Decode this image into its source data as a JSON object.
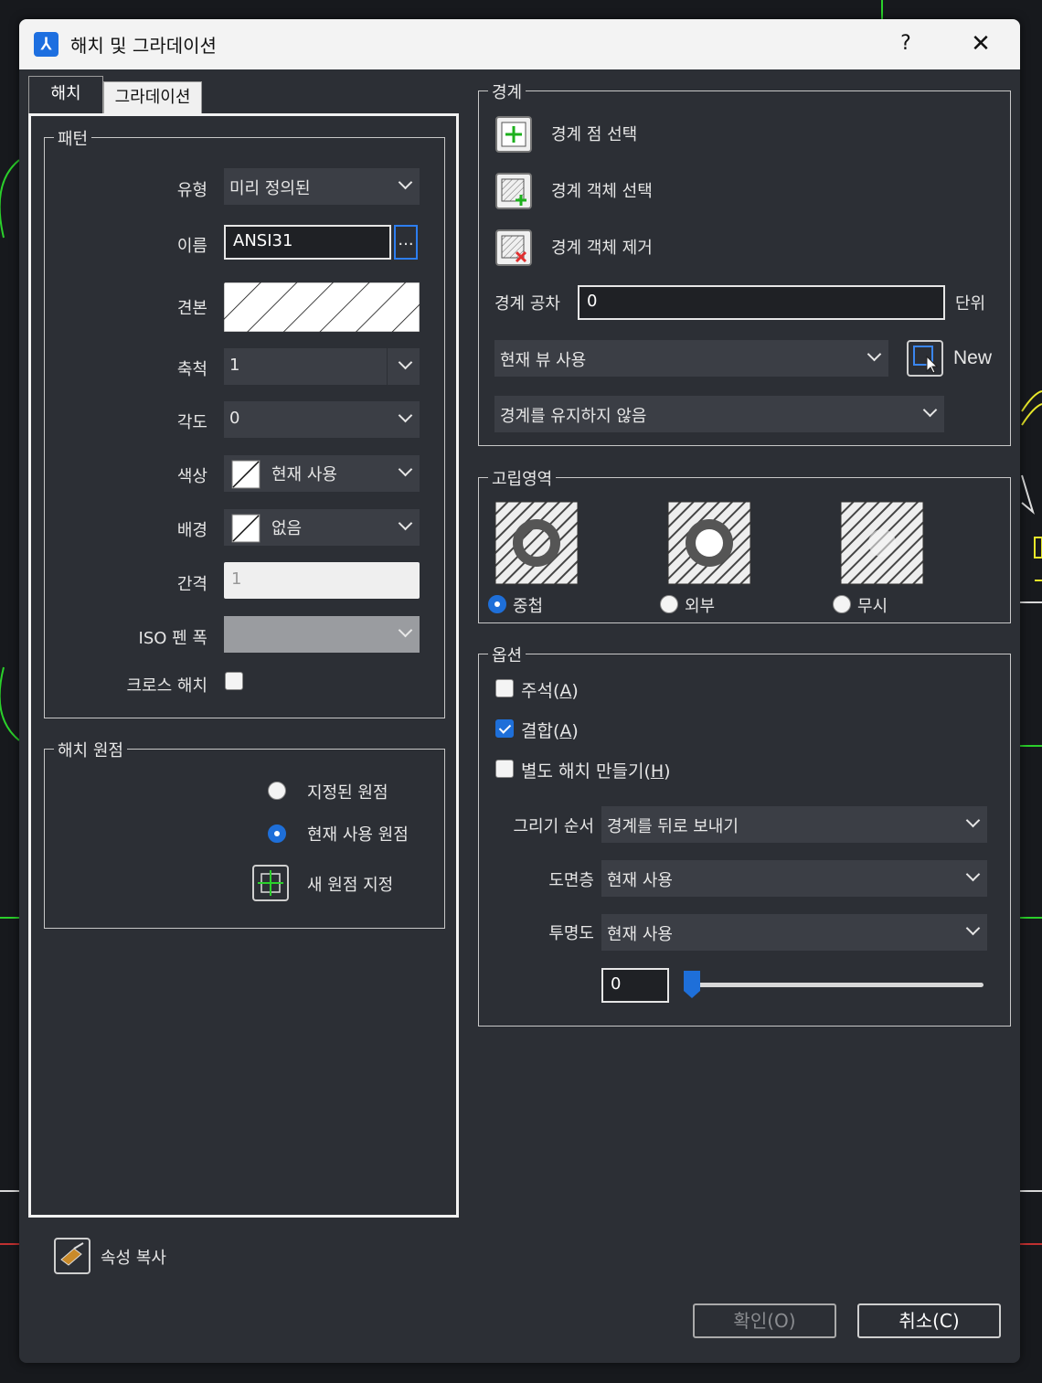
{
  "window": {
    "title": "해치 및 그라데이션",
    "help": "?",
    "close": "✕"
  },
  "tabs": [
    {
      "label": "해치",
      "active": true
    },
    {
      "label": "그라데이션",
      "active": false
    }
  ],
  "pattern": {
    "legend": "패턴",
    "type_label": "유형",
    "type_value": "미리 정의된",
    "name_label": "이름",
    "name_value": "ANSI31",
    "name_browse": "...",
    "sample_label": "견본",
    "scale_label": "축척",
    "scale_value": "1",
    "angle_label": "각도",
    "angle_value": "0",
    "color_label": "색상",
    "color_value": "현재 사용",
    "background_label": "배경",
    "background_value": "없음",
    "spacing_label": "간격",
    "spacing_value": "1",
    "iso_label": "ISO 펜 폭",
    "iso_value": "",
    "crosshatch_label": "크로스 해치",
    "crosshatch_checked": false
  },
  "origin": {
    "legend": "해치 원점",
    "specified_label": "지정된 원점",
    "specified_selected": false,
    "current_label": "현재 사용 원점",
    "current_selected": true,
    "new_origin_label": "새 원점 지정"
  },
  "copy_properties": {
    "label": "속성 복사"
  },
  "boundary": {
    "legend": "경계",
    "pick_points": "경계 점 선택",
    "select_objects": "경계 객체 선택",
    "remove_objects": "경계 객체 제거",
    "tolerance_label": "경계 공차",
    "tolerance_value": "0",
    "tolerance_unit": "단위",
    "view_value": "현재 뷰 사용",
    "new_label": "New",
    "retain_value": "경계를 유지하지 않음"
  },
  "islands": {
    "legend": "고립영역",
    "options": [
      {
        "label": "중첩",
        "selected": true
      },
      {
        "label": "외부",
        "selected": false
      },
      {
        "label": "무시",
        "selected": false
      }
    ]
  },
  "options": {
    "legend": "옵션",
    "annotative": {
      "label": "주석(",
      "key": "A",
      "end": ")",
      "checked": false
    },
    "associative": {
      "label": "결합(",
      "key": "A",
      "end": ")",
      "checked": true
    },
    "separate": {
      "label": "별도 해치 만들기(",
      "key": "H",
      "end": ")",
      "checked": false
    },
    "draw_order_label": "그리기 순서",
    "draw_order_value": "경계를 뒤로 보내기",
    "layer_label": "도면층",
    "layer_value": "현재 사용",
    "transparency_label": "투명도",
    "transparency_value": "현재 사용",
    "transparency_amount": "0",
    "transparency_slider_fraction": 0
  },
  "buttons": {
    "ok": "확인(O)",
    "cancel": "취소(C)"
  },
  "colors": {
    "accent": "#1e6fd9",
    "panel": "#2c2f35",
    "cad_green": "#2bd02b",
    "cad_yellow": "#e8e82a"
  }
}
